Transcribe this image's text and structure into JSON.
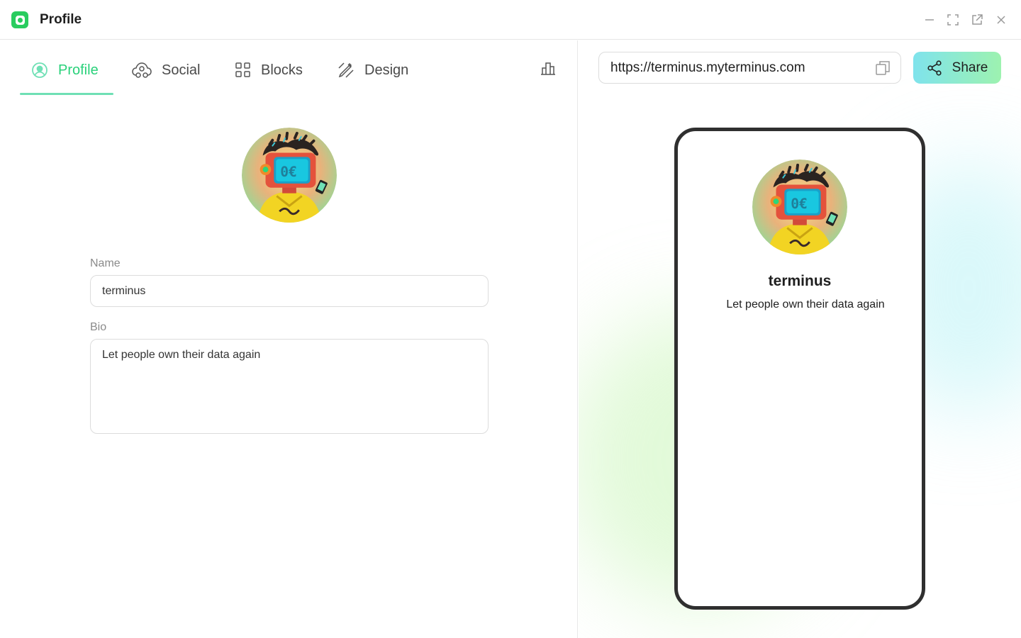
{
  "window": {
    "title": "Profile",
    "controls": [
      "minimize-icon",
      "fullscreen-icon",
      "open-external-icon",
      "close-icon"
    ]
  },
  "tabs": [
    {
      "label": "Profile",
      "icon": "user-circle-icon",
      "active": true
    },
    {
      "label": "Social",
      "icon": "social-cloud-icon",
      "active": false
    },
    {
      "label": "Blocks",
      "icon": "grid-icon",
      "active": false
    },
    {
      "label": "Design",
      "icon": "pen-icon",
      "active": false
    }
  ],
  "profile_form": {
    "name_label": "Name",
    "name_value": "terminus",
    "bio_label": "Bio",
    "bio_value": "Let people own their data again"
  },
  "share_bar": {
    "url": "https://terminus.myterminus.com",
    "share_label": "Share"
  },
  "preview": {
    "name": "terminus",
    "bio": "Let people own their data again"
  },
  "colors": {
    "accent": "#29d17a",
    "app_icon": "#29cc5f",
    "share_gradient_start": "#7fe3ec",
    "share_gradient_end": "#9df2b0"
  }
}
